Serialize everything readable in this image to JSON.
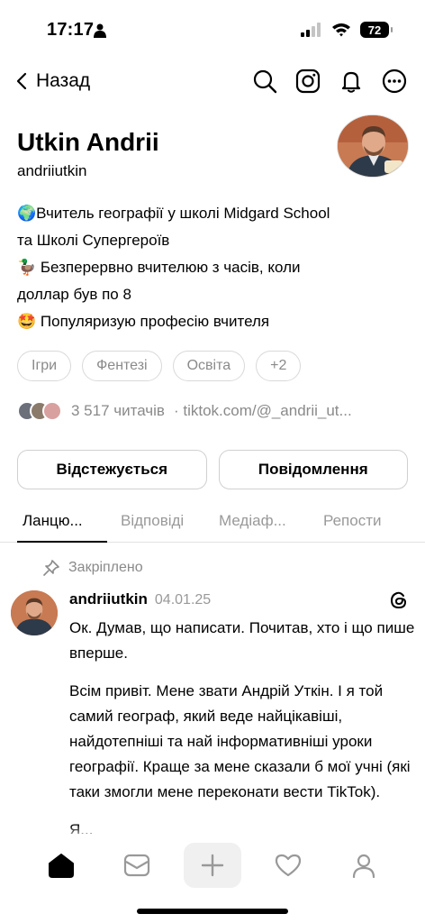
{
  "status": {
    "time": "17:17",
    "battery": "72"
  },
  "nav": {
    "back_label": "Назад"
  },
  "profile": {
    "name": "Utkin Andrii",
    "handle": "andriiutkin",
    "bio": [
      "🌍Вчитель географії у школі Midgard School",
      "та Школі Супергероїв",
      "🦆 Безперервно вчителюю з часів, коли",
      "доллар був по 8",
      "🤩 Популяризую професію вчителя"
    ],
    "chips": [
      "Ігри",
      "Фентезі",
      "Освіта",
      "+2"
    ],
    "followers": "3 517 читачів",
    "link": "· tiktok.com/@_andrii_ut..."
  },
  "actions": {
    "follow_label": "Відстежується",
    "message_label": "Повідомлення"
  },
  "tabs": [
    "Ланцю...",
    "Відповіді",
    "Медіаф...",
    "Репости"
  ],
  "post": {
    "pinned_label": "Закріплено",
    "user": "andriiutkin",
    "date": "04.01.25",
    "paragraph1": "Ок. Думав, що написати. Почитав, хто і що пише вперше.",
    "paragraph2": "Всім привіт. Мене звати Андрій Уткін. І я той самий географ, який веде найцікавіші, найдотепніші та най інформативніші уроки географії. Краще за мене сказали б мої учні (які таки змогли мене переконати вести TikTok).",
    "cutoff": "Я..."
  },
  "colors": {
    "muted": "#8a8a8a",
    "border": "#d9d9d9",
    "avatar": "#c87a52"
  }
}
